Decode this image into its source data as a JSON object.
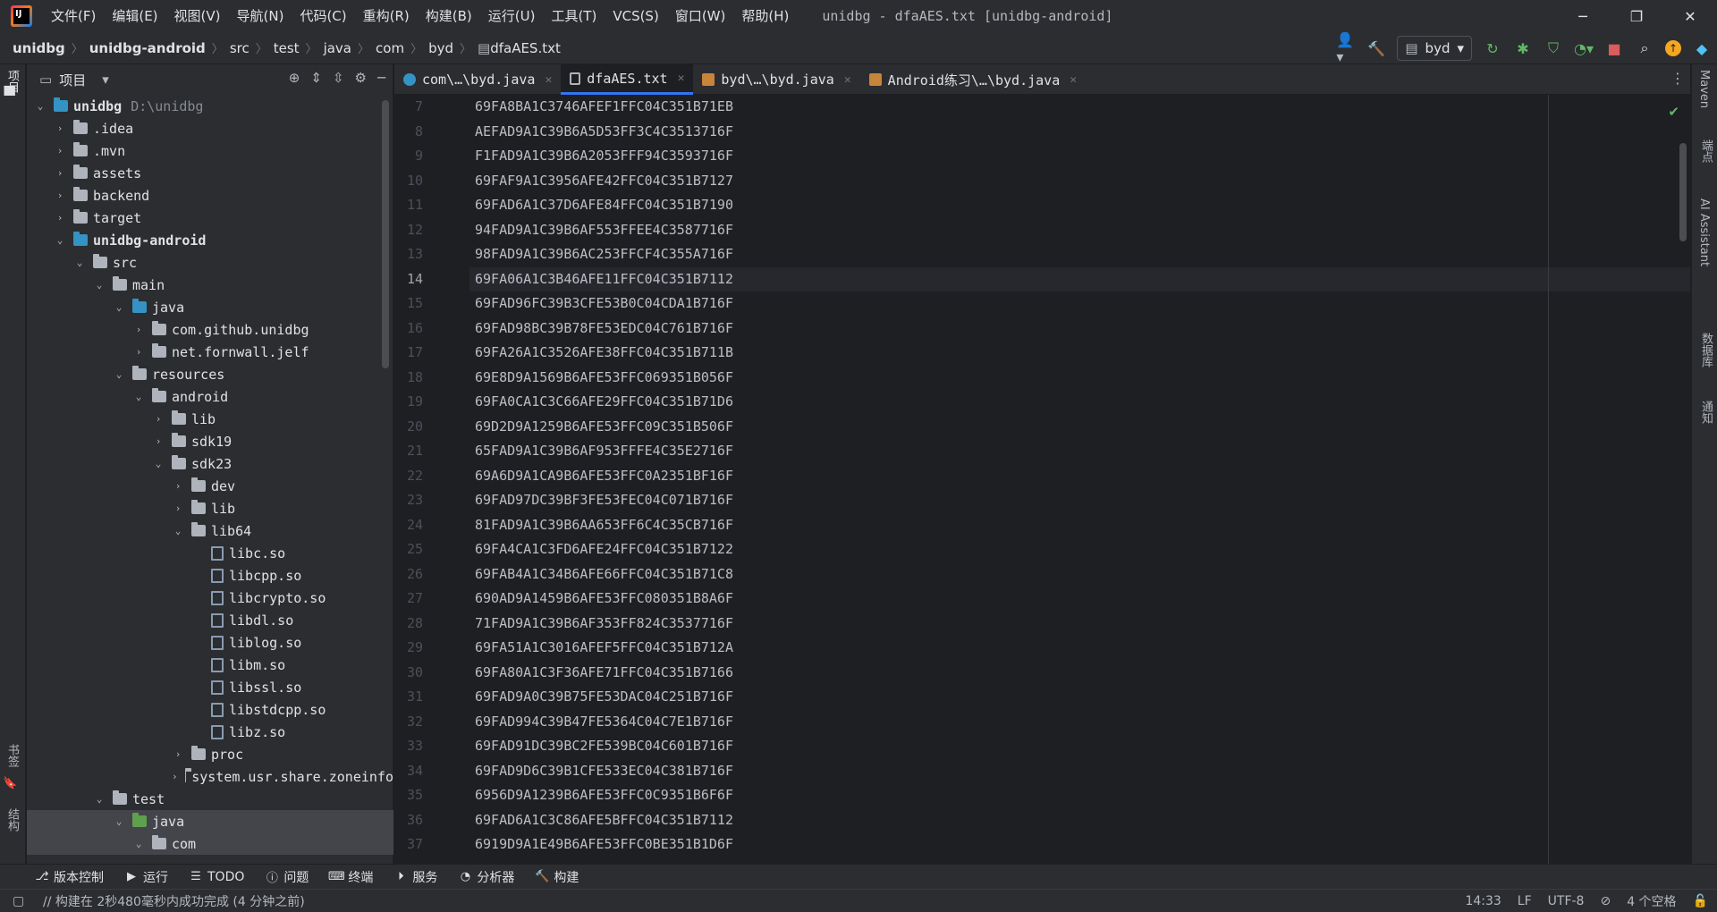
{
  "window": {
    "title": "unidbg - dfaAES.txt [unidbg-android]",
    "menu": [
      "文件(F)",
      "编辑(E)",
      "视图(V)",
      "导航(N)",
      "代码(C)",
      "重构(R)",
      "构建(B)",
      "运行(U)",
      "工具(T)",
      "VCS(S)",
      "窗口(W)",
      "帮助(H)"
    ]
  },
  "breadcrumb": [
    "unidbg",
    "unidbg-android",
    "src",
    "test",
    "java",
    "com",
    "byd",
    "dfaAES.txt"
  ],
  "run_config": "byd",
  "project_panel": {
    "title": "项目",
    "tree": [
      {
        "label": "unidbg",
        "extra": "D:\\unidbg",
        "depth": 0,
        "expanded": true,
        "icon": "folder-blue",
        "bold": true
      },
      {
        "label": ".idea",
        "depth": 1,
        "expanded": false,
        "icon": "folder"
      },
      {
        "label": ".mvn",
        "depth": 1,
        "expanded": false,
        "icon": "folder"
      },
      {
        "label": "assets",
        "depth": 1,
        "expanded": false,
        "icon": "folder"
      },
      {
        "label": "backend",
        "depth": 1,
        "expanded": false,
        "icon": "folder"
      },
      {
        "label": "target",
        "depth": 1,
        "expanded": false,
        "icon": "folder"
      },
      {
        "label": "unidbg-android",
        "depth": 1,
        "expanded": true,
        "icon": "folder-blue",
        "bold": true
      },
      {
        "label": "src",
        "depth": 2,
        "expanded": true,
        "icon": "folder"
      },
      {
        "label": "main",
        "depth": 3,
        "expanded": true,
        "icon": "folder"
      },
      {
        "label": "java",
        "depth": 4,
        "expanded": true,
        "icon": "folder-blue"
      },
      {
        "label": "com.github.unidbg",
        "depth": 5,
        "expanded": false,
        "icon": "package"
      },
      {
        "label": "net.fornwall.jelf",
        "depth": 5,
        "expanded": false,
        "icon": "package"
      },
      {
        "label": "resources",
        "depth": 4,
        "expanded": true,
        "icon": "folder"
      },
      {
        "label": "android",
        "depth": 5,
        "expanded": true,
        "icon": "folder"
      },
      {
        "label": "lib",
        "depth": 6,
        "expanded": false,
        "icon": "folder"
      },
      {
        "label": "sdk19",
        "depth": 6,
        "expanded": false,
        "icon": "folder"
      },
      {
        "label": "sdk23",
        "depth": 6,
        "expanded": true,
        "icon": "folder"
      },
      {
        "label": "dev",
        "depth": 7,
        "expanded": false,
        "icon": "folder"
      },
      {
        "label": "lib",
        "depth": 7,
        "expanded": false,
        "icon": "folder"
      },
      {
        "label": "lib64",
        "depth": 7,
        "expanded": true,
        "icon": "folder"
      },
      {
        "label": "libc.so",
        "depth": 8,
        "icon": "so-file"
      },
      {
        "label": "libcpp.so",
        "depth": 8,
        "icon": "so-file"
      },
      {
        "label": "libcrypto.so",
        "depth": 8,
        "icon": "so-file"
      },
      {
        "label": "libdl.so",
        "depth": 8,
        "icon": "so-file"
      },
      {
        "label": "liblog.so",
        "depth": 8,
        "icon": "so-file"
      },
      {
        "label": "libm.so",
        "depth": 8,
        "icon": "so-file"
      },
      {
        "label": "libssl.so",
        "depth": 8,
        "icon": "so-file"
      },
      {
        "label": "libstdcpp.so",
        "depth": 8,
        "icon": "so-file"
      },
      {
        "label": "libz.so",
        "depth": 8,
        "icon": "so-file"
      },
      {
        "label": "proc",
        "depth": 7,
        "expanded": false,
        "icon": "folder"
      },
      {
        "label": "system.usr.share.zoneinfo",
        "depth": 7,
        "expanded": false,
        "icon": "folder"
      },
      {
        "label": "test",
        "depth": 3,
        "expanded": true,
        "icon": "folder"
      },
      {
        "label": "java",
        "depth": 4,
        "expanded": true,
        "icon": "folder-green",
        "selected": true
      },
      {
        "label": "com",
        "depth": 5,
        "expanded": true,
        "icon": "folder",
        "selected": true
      }
    ]
  },
  "tabs": [
    {
      "label": "com\\…\\byd.java",
      "icon": "java-class-icon",
      "active": false
    },
    {
      "label": "dfaAES.txt",
      "icon": "text-file-icon",
      "active": true
    },
    {
      "label": "byd\\…\\byd.java",
      "icon": "java-file-icon",
      "active": false
    },
    {
      "label": "Android练习\\…\\byd.java",
      "icon": "java-file-icon",
      "active": false
    }
  ],
  "editor": {
    "current_line": 14,
    "lines": [
      {
        "n": "7",
        "text": "69FA8BA1C3746AFEF1FFC04C351B71EB"
      },
      {
        "n": "8",
        "text": "AEFAD9A1C39B6A5D53FF3C4C3513716F"
      },
      {
        "n": "9",
        "text": "F1FAD9A1C39B6A2053FFF94C3593716F"
      },
      {
        "n": "10",
        "text": "69FAF9A1C3956AFE42FFC04C351B7127"
      },
      {
        "n": "11",
        "text": "69FAD6A1C37D6AFE84FFC04C351B7190"
      },
      {
        "n": "12",
        "text": "94FAD9A1C39B6AF553FFEE4C3587716F"
      },
      {
        "n": "13",
        "text": "98FAD9A1C39B6AC253FFCF4C355A716F"
      },
      {
        "n": "14",
        "text": "69FA06A1C3B46AFE11FFC04C351B7112"
      },
      {
        "n": "15",
        "text": "69FAD96FC39B3CFE53B0C04CDA1B716F"
      },
      {
        "n": "16",
        "text": "69FAD98BC39B78FE53EDC04C761B716F"
      },
      {
        "n": "17",
        "text": "69FA26A1C3526AFE38FFC04C351B711B"
      },
      {
        "n": "18",
        "text": "69E8D9A1569B6AFE53FFC069351B056F"
      },
      {
        "n": "19",
        "text": "69FA0CA1C3C66AFE29FFC04C351B71D6"
      },
      {
        "n": "20",
        "text": "69D2D9A1259B6AFE53FFC09C351B506F"
      },
      {
        "n": "21",
        "text": "65FAD9A1C39B6AF953FFFE4C35E2716F"
      },
      {
        "n": "22",
        "text": "69A6D9A1CA9B6AFE53FFC0A2351BF16F"
      },
      {
        "n": "23",
        "text": "69FAD97DC39BF3FE53FEC04C071B716F"
      },
      {
        "n": "24",
        "text": "81FAD9A1C39B6AA653FF6C4C35CB716F"
      },
      {
        "n": "25",
        "text": "69FA4CA1C3FD6AFE24FFC04C351B7122"
      },
      {
        "n": "26",
        "text": "69FAB4A1C34B6AFE66FFC04C351B71C8"
      },
      {
        "n": "27",
        "text": "690AD9A1459B6AFE53FFC080351B8A6F"
      },
      {
        "n": "28",
        "text": "71FAD9A1C39B6AF353FF824C3537716F"
      },
      {
        "n": "29",
        "text": "69FA51A1C3016AFEF5FFC04C351B712A"
      },
      {
        "n": "30",
        "text": "69FA80A1C3F36AFE71FFC04C351B7166"
      },
      {
        "n": "31",
        "text": "69FAD9A0C39B75FE53DAC04C251B716F"
      },
      {
        "n": "32",
        "text": "69FAD994C39B47FE5364C04C7E1B716F"
      },
      {
        "n": "33",
        "text": "69FAD91DC39BC2FE539BC04C601B716F"
      },
      {
        "n": "34",
        "text": "69FAD9D6C39B1CFE533EC04C381B716F"
      },
      {
        "n": "35",
        "text": "6956D9A1239B6AFE53FFC0C9351B6F6F"
      },
      {
        "n": "36",
        "text": "69FAD6A1C3C86AFE5BFFC04C351B7112"
      },
      {
        "n": "37",
        "text": "6919D9A1E49B6AFE53FFC0BE351B1D6F"
      }
    ]
  },
  "left_strip": {
    "project": "项目",
    "bookmarks": "书签",
    "structure": "结构"
  },
  "right_strip": [
    "Maven",
    "端点",
    "AI Assistant",
    "数据库",
    "通知"
  ],
  "tool_windows": [
    "版本控制",
    "运行",
    "TODO",
    "问题",
    "终端",
    "服务",
    "分析器",
    "构建"
  ],
  "status_bar": {
    "message": "// 构建在 2秒480毫秒内成功完成 (4 分钟之前)",
    "position": "14:33",
    "line_sep": "LF",
    "encoding": "UTF-8",
    "indent": "4 个空格"
  },
  "colors": {
    "accent": "#3574f0",
    "bg": "#1e1f22",
    "panel": "#2b2d30",
    "green": "#5fb865",
    "red": "#db5c5c"
  }
}
